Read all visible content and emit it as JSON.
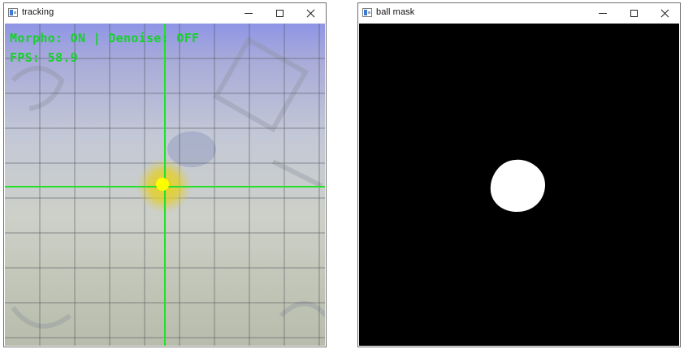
{
  "windows": {
    "tracking": {
      "title": "tracking",
      "overlay": {
        "status_line": "Morpho: ON | Denoise: OFF",
        "fps_line": "FPS: 58.9"
      },
      "colors": {
        "crosshair": "#22e02c",
        "ball_marker": "#ffff00",
        "ball_glow": "#e6d420",
        "overlay_text": "#16d22a"
      }
    },
    "mask": {
      "title": "ball mask",
      "colors": {
        "background": "#000000",
        "blob": "#ffffff"
      }
    }
  },
  "icons": {
    "app_icon": "opencv-window-icon",
    "minimize": "minimize-icon",
    "maximize": "maximize-icon",
    "close": "close-icon"
  }
}
